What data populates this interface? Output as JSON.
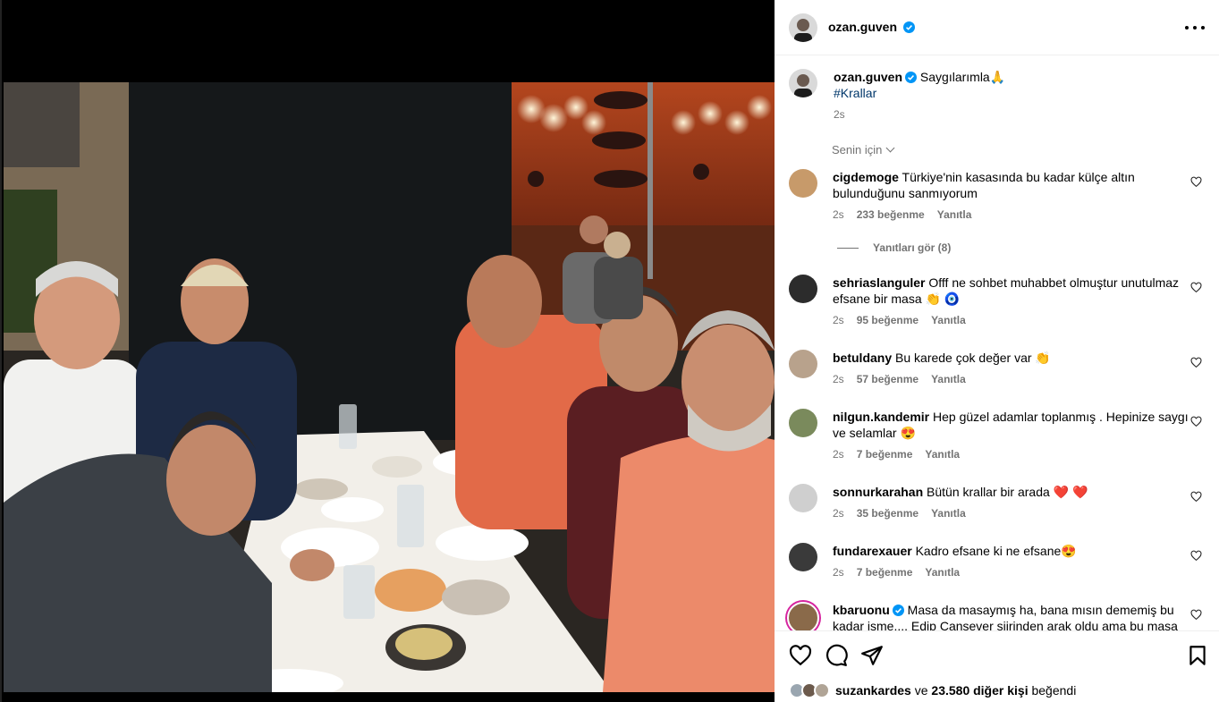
{
  "post": {
    "author": "ozan.guven",
    "more_label": "More options"
  },
  "caption": {
    "author": "ozan.guven",
    "text": "Saygılarımla🙏",
    "hashtag": "#Krallar",
    "time": "2s"
  },
  "for_you_label": "Senin için",
  "comments": [
    {
      "user": "cigdemoge",
      "text": "Türkiye'nin kasasında bu kadar külçe altın bulunduğunu sanmıyorum",
      "time": "2s",
      "likes": "233 beğenme",
      "reply": "Yanıtla",
      "avatar_color": "#c79a6a"
    },
    {
      "user": "sehriaslanguler",
      "text": "Offf ne sohbet muhabbet olmuştur unutulmaz efsane bir masa 👏 🧿",
      "time": "2s",
      "likes": "95 beğenme",
      "reply": "Yanıtla",
      "avatar_color": "#2c2c2c"
    },
    {
      "user": "betuldany",
      "text": "Bu karede çok değer var 👏",
      "time": "2s",
      "likes": "57 beğenme",
      "reply": "Yanıtla",
      "avatar_color": "#b8a28c"
    },
    {
      "user": "nilgun.kandemir",
      "text": "Hep güzel adamlar toplanmış . Hepinize saygı ve selamlar 😍",
      "time": "2s",
      "likes": "7 beğenme",
      "reply": "Yanıtla",
      "avatar_color": "#7a8a5c"
    },
    {
      "user": "sonnurkarahan",
      "text": "Bütün krallar bir arada ❤️ ❤️",
      "time": "2s",
      "likes": "35 beğenme",
      "reply": "Yanıtla",
      "avatar_color": "#cfcfcf"
    },
    {
      "user": "fundarexauer",
      "text": "Kadro efsane ki ne efsane😍",
      "time": "2s",
      "likes": "7 beğenme",
      "reply": "Yanıtla",
      "avatar_color": "#3a3a3a"
    },
    {
      "user": "kbaruonu",
      "text": "Masa da masaymış ha, bana mısın dememiş bu kadar isme.... Edip Cansever şiirinden arak oldu ama bu masa",
      "time": "",
      "likes": "",
      "reply": "",
      "avatar_color": "#8a6a4a"
    }
  ],
  "view_replies": "Yanıtları gör (8)",
  "likes_line": {
    "user": "suzankardes",
    "conj": "ve",
    "others": "23.580 diğer kişi",
    "suffix": "beğendi"
  },
  "colors": {
    "verified": "#0095f6",
    "heart": "#ed4956"
  }
}
